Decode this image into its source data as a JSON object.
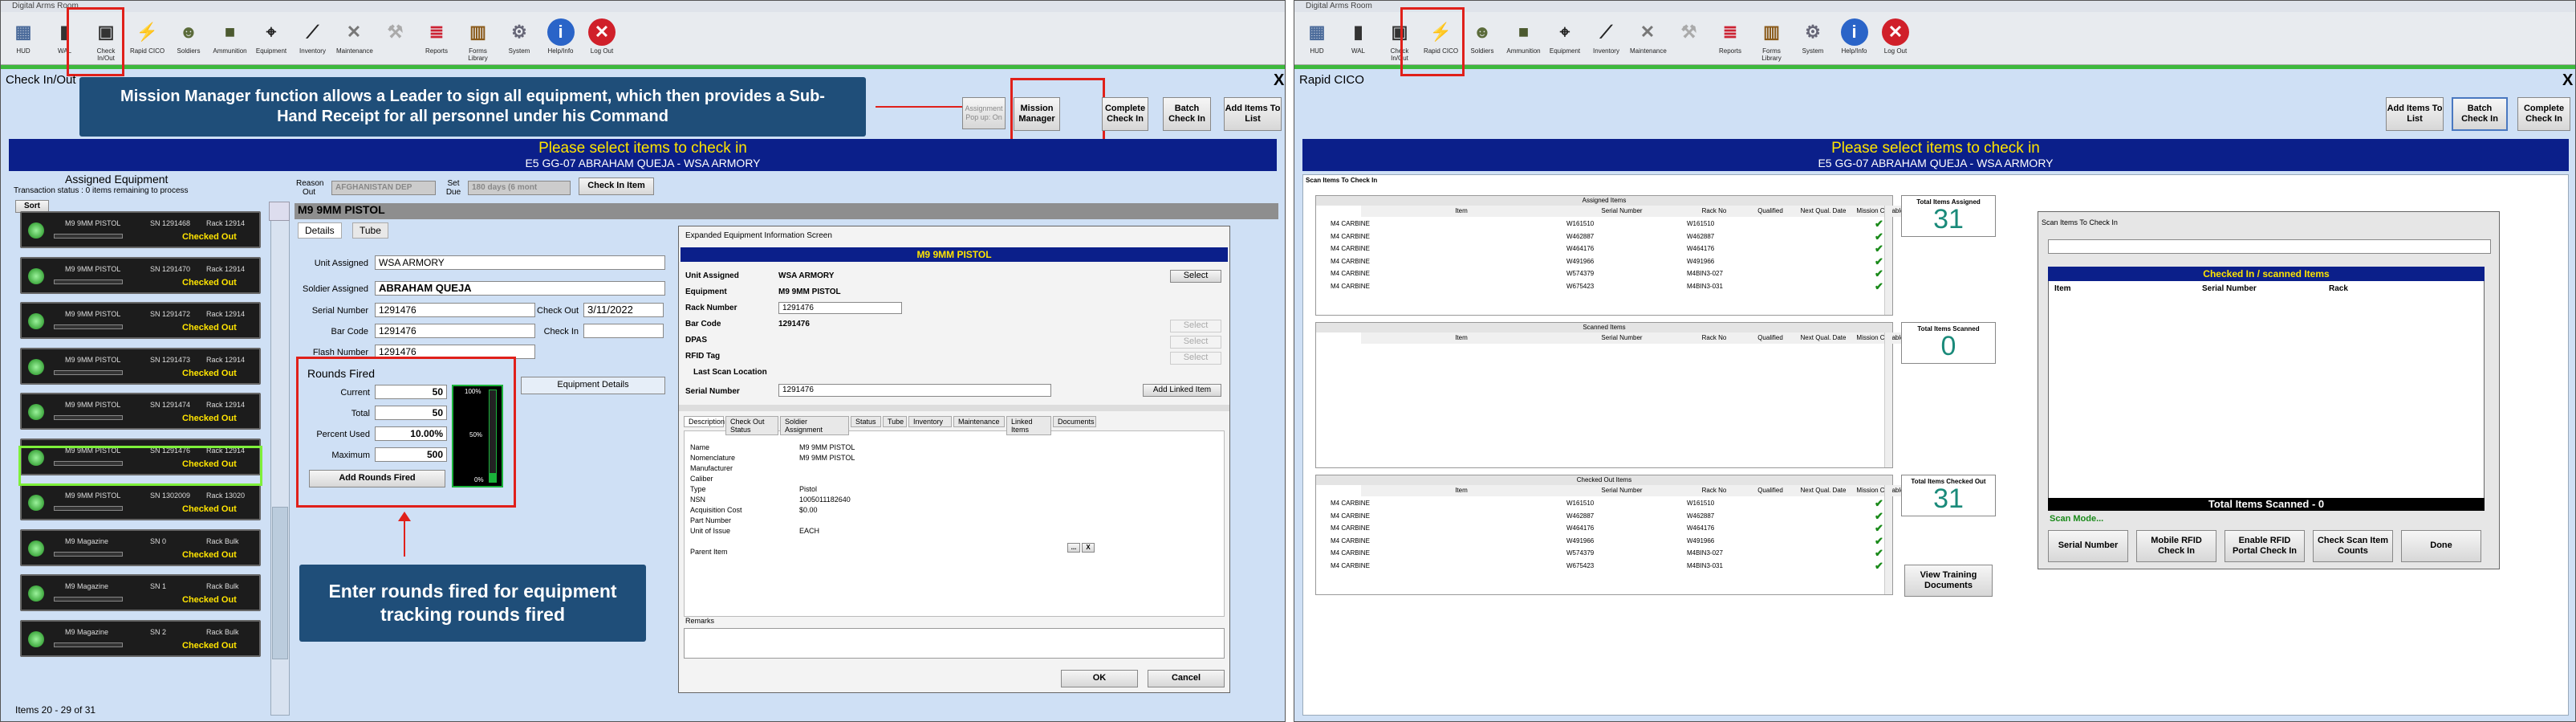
{
  "left": {
    "window_title": "Digital Arms Room",
    "toolbar": [
      {
        "label": "HUD",
        "icon": "hud-icon",
        "glyph": "▦",
        "color": "#4a6a9a"
      },
      {
        "label": "WAL",
        "icon": "wal-icon",
        "glyph": "▮",
        "color": "#333"
      },
      {
        "label": "Check In/Out",
        "icon": "check-in-out-icon",
        "glyph": "▣",
        "color": "#333"
      },
      {
        "label": "Rapid CICO",
        "icon": "lightning-icon",
        "glyph": "⚡",
        "color": "#e8c800"
      },
      {
        "label": "Soldiers",
        "icon": "soldier-icon",
        "glyph": "☻",
        "color": "#5b6b3a"
      },
      {
        "label": "Ammunition",
        "icon": "ammunition-box-icon",
        "glyph": "■",
        "color": "#4c5a30"
      },
      {
        "label": "Equipment",
        "icon": "equipment-icon",
        "glyph": "⌖",
        "color": "#222"
      },
      {
        "label": "Inventory",
        "icon": "inventory-icon",
        "glyph": "⟋",
        "color": "#222"
      },
      {
        "label": "Maintenance",
        "icon": "wrench-icon",
        "glyph": "✕",
        "color": "#777"
      },
      {
        "label": "",
        "icon": "disabled-tool-icon",
        "glyph": "⚒",
        "color": "#aaa"
      },
      {
        "label": "Reports",
        "icon": "report-icon",
        "glyph": "≣",
        "color": "#c23"
      },
      {
        "label": "Forms Library",
        "icon": "book-icon",
        "glyph": "▥",
        "color": "#8a5a1a"
      },
      {
        "label": "System",
        "icon": "gear-icon",
        "glyph": "⚙",
        "color": "#667"
      },
      {
        "label": "Help/Info",
        "icon": "info-icon",
        "glyph": "i",
        "color": "#fff"
      },
      {
        "label": "Log Out",
        "icon": "logout-icon",
        "glyph": "✕",
        "color": "#fff"
      }
    ],
    "screen_title": "Check In/Out",
    "callout_top": "Mission Manager function allows a Leader to sign all equipment, which then provides a Sub-Hand Receipt for all personnel under his Command",
    "callout_bottom": "Enter rounds fired for equipment tracking rounds fired",
    "assignment_popup": "Assignment Pop up: On",
    "buttons": {
      "mission_manager": "Mission Manager",
      "complete_check_in": "Complete Check In",
      "batch_check_in": "Batch Check In",
      "add_items": "Add Items To List",
      "check_in_item": "Check In Item",
      "sort": "Sort",
      "equipment_details": "Equipment Details",
      "add_rounds_fired": "Add Rounds Fired"
    },
    "banner_main": "Please select items to check in",
    "banner_sub": "E5 GG-07 ABRAHAM QUEJA  -  WSA ARMORY",
    "assigned_title": "Assigned Equipment",
    "transaction_status": "Transaction status : 0 items remaining to process",
    "reason_out_label": "Reason Out",
    "reason_out_value": "AFGHANISTAN DEP",
    "set_due_label": "Set Due",
    "set_due_value": "180 days (6 mont",
    "items": [
      {
        "name": "M9 9MM PISTOL",
        "sn": "SN  1291468",
        "rack": "Rack  12914",
        "status": "Checked Out"
      },
      {
        "name": "M9 9MM PISTOL",
        "sn": "SN  1291470",
        "rack": "Rack  12914",
        "status": "Checked Out"
      },
      {
        "name": "M9 9MM PISTOL",
        "sn": "SN  1291472",
        "rack": "Rack  12914",
        "status": "Checked Out"
      },
      {
        "name": "M9 9MM PISTOL",
        "sn": "SN  1291473",
        "rack": "Rack  12914",
        "status": "Checked Out"
      },
      {
        "name": "M9 9MM PISTOL",
        "sn": "SN  1291474",
        "rack": "Rack  12914",
        "status": "Checked Out"
      },
      {
        "name": "M9 9MM PISTOL",
        "sn": "SN  1291476",
        "rack": "Rack  12914",
        "status": "Checked Out"
      },
      {
        "name": "M9 9MM PISTOL",
        "sn": "SN  1302009",
        "rack": "Rack  13020",
        "status": "Checked Out"
      },
      {
        "name": "M9 Magazine",
        "sn": "SN  0",
        "rack": "Rack  Bulk",
        "status": "Checked Out"
      },
      {
        "name": "M9 Magazine",
        "sn": "SN  1",
        "rack": "Rack  Bulk",
        "status": "Checked Out"
      },
      {
        "name": "M9 Magazine",
        "sn": "SN  2",
        "rack": "Rack  Bulk",
        "status": "Checked Out"
      }
    ],
    "items_footer": "Items 20 - 29 of 31",
    "detail_title": "M9 9MM PISTOL",
    "detail_tabs": [
      "Details",
      "Tube"
    ],
    "fields": {
      "unit_assigned_label": "Unit Assigned",
      "unit_assigned": "WSA ARMORY",
      "soldier_label": "Soldier Assigned",
      "soldier": "ABRAHAM QUEJA",
      "serial_label": "Serial Number",
      "serial": "1291476",
      "checkout_label": "Check Out",
      "checkout": "3/11/2022",
      "barcode_label": "Bar Code",
      "barcode": "1291476",
      "checkin_label": "Check In",
      "checkin": "",
      "flash_label": "Flash Number",
      "flash": "1291476"
    },
    "rounds": {
      "title": "Rounds Fired",
      "current_label": "Current",
      "current": "50",
      "total_label": "Total",
      "total": "50",
      "percent_label": "Percent Used",
      "percent": "10.00%",
      "max_label": "Maximum",
      "max": "500",
      "gauge_top": "100%",
      "gauge_mid": "50%",
      "gauge_bot": "0%",
      "gauge_fraction": 0.1
    },
    "dialog": {
      "title": "Expanded Equipment Information Screen",
      "header": "M9 9MM PISTOL",
      "rows": [
        {
          "k": "Unit Assigned",
          "v": "WSA ARMORY"
        },
        {
          "k": "Equipment",
          "v": "M9 9MM PISTOL"
        },
        {
          "k": "Rack Number",
          "v": "1291476"
        },
        {
          "k": "Bar Code",
          "v": "1291476"
        },
        {
          "k": "DPAS",
          "v": ""
        },
        {
          "k": "RFID Tag",
          "v": ""
        }
      ],
      "last_scan": "Last Scan Location",
      "serial_label": "Serial Number",
      "serial": "1291476",
      "select": "Select",
      "add_linked": "Add Linked Item",
      "tabs": [
        "Description",
        "Check Out Status",
        "Soldier Assignment",
        "Status",
        "Tube",
        "Inventory",
        "Maintenance",
        "Linked Items",
        "Documents"
      ],
      "desc": [
        {
          "k": "Name",
          "v": "M9 9MM PISTOL"
        },
        {
          "k": "Nomenclature",
          "v": "M9 9MM PISTOL"
        },
        {
          "k": "Manufacturer",
          "v": ""
        },
        {
          "k": "Caliber",
          "v": ""
        },
        {
          "k": "Type",
          "v": "Pistol"
        },
        {
          "k": "NSN",
          "v": "1005011182640"
        },
        {
          "k": "Acquisition Cost",
          "v": "$0.00"
        },
        {
          "k": "Part Number",
          "v": ""
        },
        {
          "k": "Unit of Issue",
          "v": "EACH"
        },
        {
          "k": "",
          "v": ""
        },
        {
          "k": "Parent Item",
          "v": ""
        }
      ],
      "remarks": "Remarks",
      "ok": "OK",
      "cancel": "Cancel"
    }
  },
  "right": {
    "window_title": "Digital Arms Room",
    "screen_title": "Rapid CICO",
    "buttons": {
      "add_items": "Add Items To List",
      "batch_check_in": "Batch Check In",
      "complete_check_in": "Complete Check In",
      "view_training": "View Training Documents"
    },
    "banner_main": "Please select items to check in",
    "banner_sub": "E5 GG-07 ABRAHAM QUEJA  -  WSA ARMORY",
    "scan_items_label": "Scan Items To Check In",
    "columns": [
      "Item",
      "Serial Number",
      "Rack No",
      "Qualified",
      "Next Qual. Date",
      "Mission Capable"
    ],
    "assigned": {
      "title": "Assigned Items",
      "rows": [
        {
          "item": "M4 CARBINE",
          "serial": "W161510",
          "rack": "W161510"
        },
        {
          "item": "M4 CARBINE",
          "serial": "W462887",
          "rack": "W462887"
        },
        {
          "item": "M4 CARBINE",
          "serial": "W464176",
          "rack": "W464176"
        },
        {
          "item": "M4 CARBINE",
          "serial": "W491966",
          "rack": "W491966"
        },
        {
          "item": "M4 CARBINE",
          "serial": "W574379",
          "rack": "M4BIN3-027"
        },
        {
          "item": "M4 CARBINE",
          "serial": "W675423",
          "rack": "M4BIN3-031"
        }
      ]
    },
    "scanned": {
      "title": "Scanned Items"
    },
    "checked_out": {
      "title": "Checked Out Items",
      "rows": [
        {
          "item": "M4 CARBINE",
          "serial": "W161510",
          "rack": "W161510"
        },
        {
          "item": "M4 CARBINE",
          "serial": "W462887",
          "rack": "W462887"
        },
        {
          "item": "M4 CARBINE",
          "serial": "W464176",
          "rack": "W464176"
        },
        {
          "item": "M4 CARBINE",
          "serial": "W491966",
          "rack": "W491966"
        },
        {
          "item": "M4 CARBINE",
          "serial": "W574379",
          "rack": "M4BIN3-027"
        },
        {
          "item": "M4 CARBINE",
          "serial": "W675423",
          "rack": "M4BIN3-031"
        }
      ]
    },
    "counts": {
      "assigned_label": "Total Items Assigned",
      "assigned": "31",
      "scanned_label": "Total Items Scanned",
      "scanned": "0",
      "checked_out_label": "Total Items Checked Out",
      "checked_out": "31"
    },
    "scan_dialog": {
      "title": "Scan Items To Check In",
      "list_title": "Checked In / scanned Items",
      "cols": [
        "Item",
        "Serial Number",
        "Rack"
      ],
      "total": "Total Items Scanned - 0",
      "mode": "Scan Mode...",
      "buttons": [
        "Serial Number",
        "Mobile RFID Check In",
        "Enable RFID Portal Check In",
        "Check Scan Item Counts",
        "Done"
      ]
    }
  }
}
